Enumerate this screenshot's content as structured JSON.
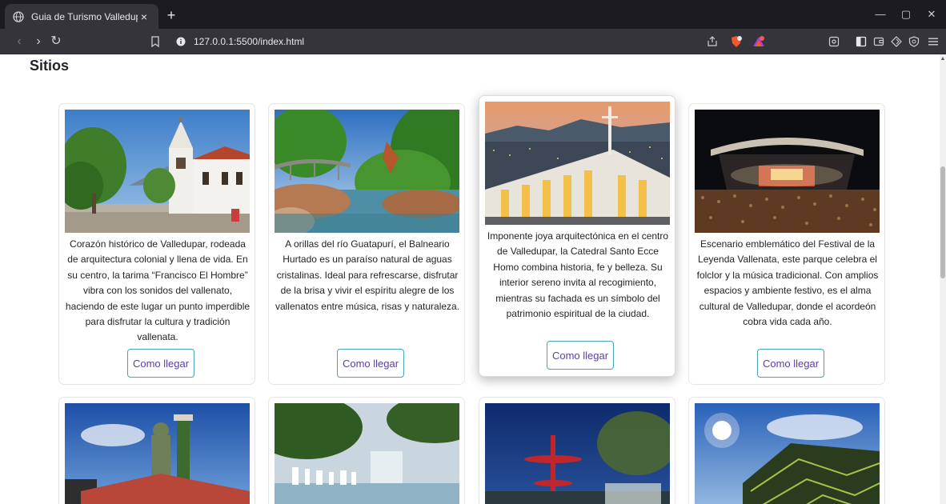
{
  "browser": {
    "tab_title": "Guia de Turismo Valledupar",
    "tab_close": "×",
    "new_tab": "+",
    "url": "127.0.0.1:5500/index.html",
    "window_minimize": "—",
    "window_restore": "▢",
    "window_close": "✕",
    "nav_back": "‹",
    "nav_forward": "›",
    "nav_reload": "↻"
  },
  "page": {
    "section_title": "Sitios"
  },
  "cards": [
    {
      "description": "Corazón histórico de Valledupar, rodeada de arquitectura colonial y llena de vida. En su centro, la tarima “Francisco El Hombre” vibra con los sonidos del vallenato, haciendo de este lugar un punto imperdible para disfrutar la cultura y tradición vallenata.",
      "button": "Como llegar"
    },
    {
      "description": "A orillas del río Guatapurí, el Balneario Hurtado es un paraíso natural de aguas cristalinas. Ideal para refrescarse, disfrutar de la brisa y vivir el espíritu alegre de los vallenatos entre música, risas y naturaleza.",
      "button": "Como llegar"
    },
    {
      "description": "Imponente joya arquitectónica en el centro de Valledupar, la Catedral Santo Ecce Homo combina historia, fe y belleza. Su interior sereno invita al recogimiento, mientras su fachada es un símbolo del patrimonio espiritual de la ciudad.",
      "button": "Como llegar"
    },
    {
      "description": "Escenario emblemático del Festival de la Leyenda Vallenata, este parque celebra el folclor y la música tradicional. Con amplios espacios y ambiente festivo, es el alma cultural de Valledupar, donde el acordeón cobra vida cada año.",
      "button": "Como llegar"
    }
  ],
  "bottom_photos": [
    "photo-1",
    "photo-2",
    "photo-3",
    "photo-4"
  ],
  "colors": {
    "button_border": "#4aa3b8",
    "button_text": "#5b3fa3",
    "chrome_dark": "#1c1b22",
    "chrome_toolbar": "#35343a"
  }
}
